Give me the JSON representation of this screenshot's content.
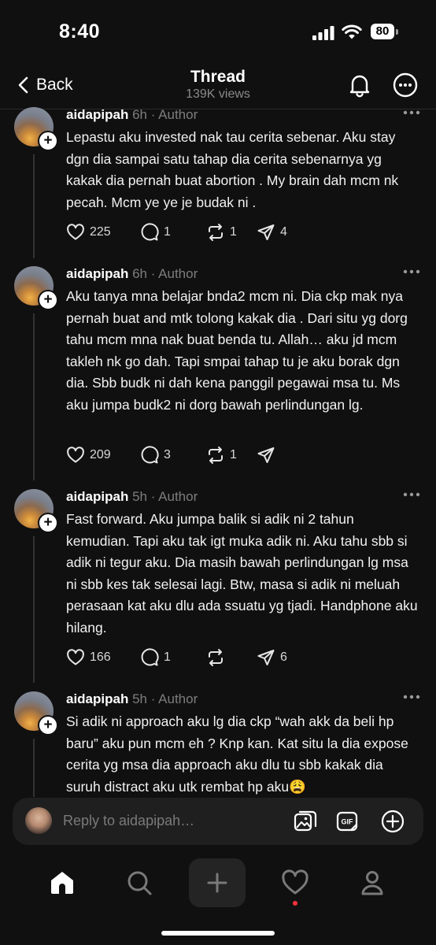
{
  "status": {
    "time": "8:40",
    "battery": "80"
  },
  "nav": {
    "back_label": "Back",
    "title": "Thread",
    "views": "139K views"
  },
  "posts": [
    {
      "author": "aidapipah",
      "meta": " 6h · Author",
      "text": "Lepastu aku invested nak tau cerita sebenar. Aku stay dgn dia sampai satu tahap dia cerita sebenarnya yg kakak dia pernah buat abortion . My brain dah mcm nk pecah. Mcm ye ye je budak ni .",
      "likes": "225",
      "replies": "1",
      "reposts": "1",
      "shares": "4"
    },
    {
      "author": "aidapipah",
      "meta": " 6h · Author",
      "text": "Aku tanya mna belajar bnda2 mcm ni. Dia ckp mak nya pernah buat and mtk tolong kakak dia . Dari situ yg dorg tahu mcm mna nak buat benda tu. Allah… aku jd mcm takleh nk go dah. Tapi smpai tahap tu je aku borak dgn dia. Sbb budk ni dah kena panggil pegawai msa tu. Ms aku jumpa budk2 ni dorg bawah perlindungan lg.",
      "likes": "209",
      "replies": "3",
      "reposts": "1",
      "shares": ""
    },
    {
      "author": "aidapipah",
      "meta": " 5h · Author",
      "text": "Fast forward. Aku jumpa balik si adik ni 2 tahun kemudian. Tapi aku tak igt muka adik ni. Aku tahu sbb si adik ni tegur aku. Dia masih bawah perlindungan lg msa ni sbb kes tak selesai lagi. Btw, masa si adik ni meluah perasaan kat aku dlu ada ssuatu yg tjadi. Handphone aku hilang.",
      "likes": "166",
      "replies": "1",
      "reposts": "",
      "shares": "6"
    },
    {
      "author": "aidapipah",
      "meta": " 5h · Author",
      "text": "Si adik ni approach aku lg dia ckp “wah akk da beli hp baru” aku pun mcm eh ? Knp kan. Kat situ la dia expose cerita yg msa dia approach aku dlu tu sbb kakak dia suruh distract aku utk rembat hp aku😩",
      "likes": "",
      "replies": "",
      "reposts": "",
      "shares": ""
    }
  ],
  "reply": {
    "placeholder": "Reply to aidapipah…"
  },
  "icons": {
    "back": "chevron-left-icon",
    "bell": "bell-icon",
    "more": "more-horizontal-icon",
    "like": "heart-icon",
    "reply": "comment-icon",
    "repost": "repost-icon",
    "share": "send-icon",
    "gallery": "image-icon",
    "gif": "gif-icon",
    "add": "plus-circle-icon",
    "home": "home-icon",
    "search": "search-icon",
    "new": "plus-icon",
    "activity": "heart-icon",
    "profile": "profile-icon"
  },
  "colors": {
    "background": "#101010",
    "notification": "#ff3040"
  }
}
